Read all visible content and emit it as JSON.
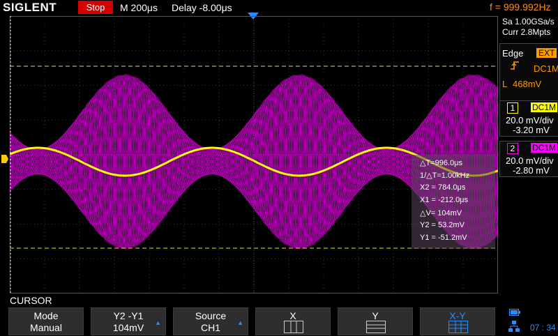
{
  "header": {
    "brand": "SIGLENT",
    "run_state": "Stop",
    "timebase": "M 200μs",
    "delay": "Delay -8.00μs",
    "frequency": "f = 999.992Hz"
  },
  "acquisition": {
    "sample_rate": "Sa 1.00GSa/s",
    "memory_depth": "Curr 2.8Mpts"
  },
  "trigger": {
    "type": "Edge",
    "source": "EXT",
    "coupling": "DC1M",
    "level_label": "L",
    "level": "468mV"
  },
  "channels": [
    {
      "number": "1",
      "coupling": "DC1M",
      "scale": "20.0 mV/div",
      "offset": "-3.20 mV",
      "color": "#ffff00"
    },
    {
      "number": "2",
      "coupling": "DC1M",
      "scale": "20.0 mV/div",
      "offset": "-2.80 mV",
      "color": "#ff00ff"
    }
  ],
  "cursor_readout": {
    "delta_t": "△T=996.0μs",
    "inv_delta_t": "1/△T=1.00kHz",
    "x2": "X2 = 784.0μs",
    "x1": "X1 = -212.0μs",
    "delta_v": "△V= 104mV",
    "y2": "Y2 = 53.2mV",
    "y1": "Y1 = -51.2mV"
  },
  "menu": {
    "title": "CURSOR",
    "softkeys": [
      {
        "top": "Mode",
        "bottom": "Manual"
      },
      {
        "top": "Y2 -Y1",
        "bottom": "104mV",
        "arrow": true
      },
      {
        "top": "Source",
        "bottom": "CH1",
        "arrow": true
      },
      {
        "top": "X",
        "icon": "x-cursor-icon"
      },
      {
        "top": "Y",
        "icon": "y-cursor-icon"
      },
      {
        "top": "X-Y",
        "icon": "xy-cursor-icon",
        "active": true
      }
    ]
  },
  "status": {
    "time": "07 : 34"
  },
  "colors": {
    "ch1": "#ffff00",
    "ch2": "#ff00ff",
    "cursor_x": "#ffffff",
    "cursor_y": "#ffff66",
    "accent": "#2a8cff",
    "trigger": "#ff9a00"
  }
}
